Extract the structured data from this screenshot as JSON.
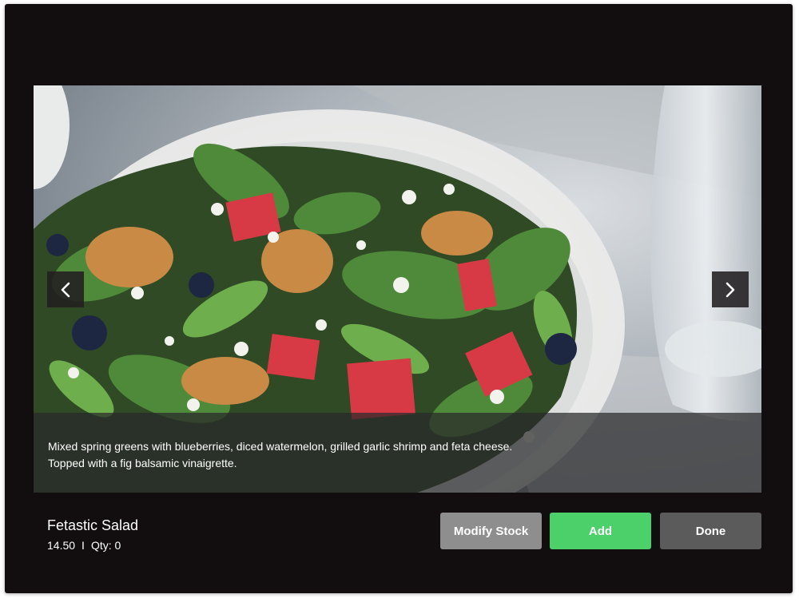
{
  "photo": {
    "alt_icon": "salad-photo",
    "description_lines": [
      "Mixed spring greens with blueberries, diced watermelon, grilled garlic shrimp and feta cheese.",
      "Topped with a fig balsamic vinaigrette."
    ]
  },
  "navigation": {
    "prev_icon": "chevron-left-icon",
    "next_icon": "chevron-right-icon"
  },
  "item": {
    "name": "Fetastic Salad",
    "price": "14.50",
    "separator": "I",
    "qty_text": "Qty: 0"
  },
  "actions": {
    "modify_label": "Modify Stock",
    "add_label": "Add",
    "done_label": "Done"
  },
  "colors": {
    "background": "#120e10",
    "add_button": "#4cd16a",
    "modify_button": "#8e8e8e",
    "done_button": "#5b5b5b"
  }
}
